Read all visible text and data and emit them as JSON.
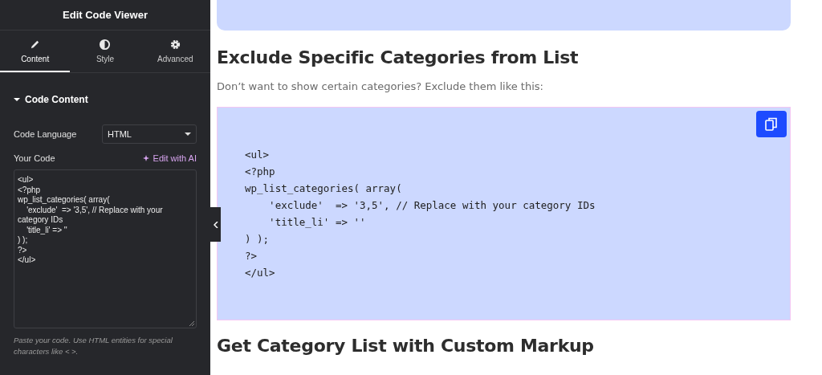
{
  "sidebar": {
    "title": "Edit Code Viewer",
    "tabs": [
      {
        "label": "Content",
        "selected": true
      },
      {
        "label": "Style",
        "selected": false
      },
      {
        "label": "Advanced",
        "selected": false
      }
    ],
    "section": {
      "title": "Code Content",
      "expanded": true
    },
    "language": {
      "label": "Code Language",
      "value": "HTML"
    },
    "code_field": {
      "label": "Your Code",
      "ai_link": "Edit with AI",
      "value": "<ul>\n<?php\nwp_list_categories( array(\n    'exclude'  => '3,5', // Replace with your category IDs\n    'title_li' => ''\n) );\n?>\n</ul>"
    },
    "help": "Paste your code. Use HTML entities for special characters like < >."
  },
  "content": {
    "heading": "Exclude Specific Categories from List",
    "paragraph": "Don’t want to show certain categories? Exclude them like this:",
    "code_lines": [
      "<ul>",
      "<?php",
      "wp_list_categories( array(",
      "    'exclude'  => '3,5', // Replace with your category IDs",
      "    'title_li' => ''",
      ") );",
      "?>",
      "</ul>"
    ],
    "next_heading": "Get Category List with Custom Markup"
  }
}
